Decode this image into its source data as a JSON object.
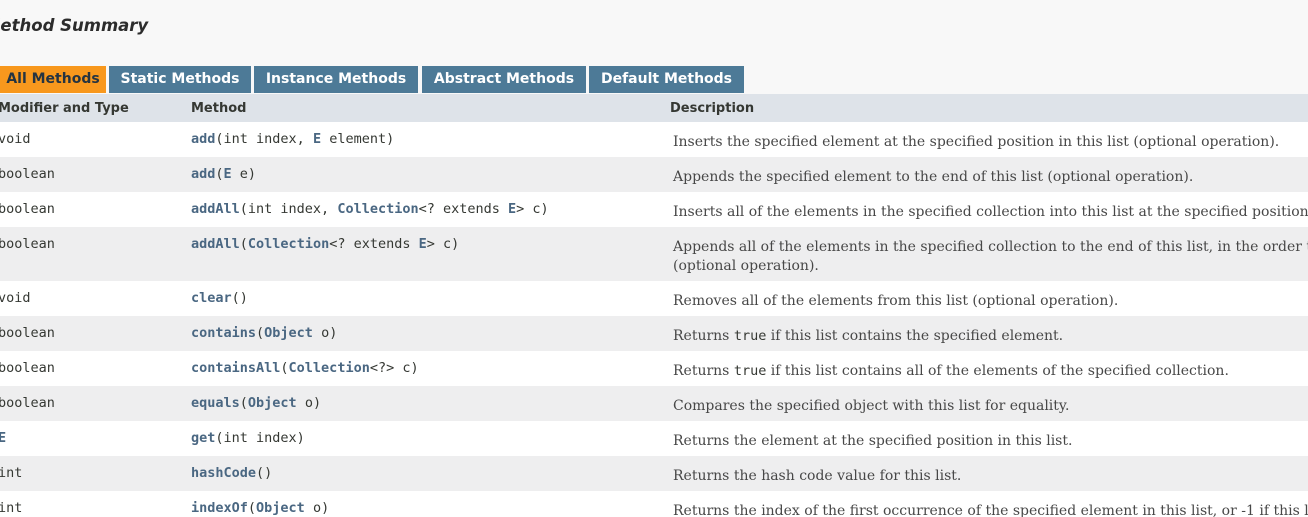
{
  "summary": {
    "title": "Method Summary"
  },
  "tabs": [
    {
      "label": "All Methods",
      "active": true
    },
    {
      "label": "Static Methods",
      "active": false
    },
    {
      "label": "Instance Methods",
      "active": false
    },
    {
      "label": "Abstract Methods",
      "active": false
    },
    {
      "label": "Default Methods",
      "active": false
    }
  ],
  "columns": {
    "type": "Modifier and Type",
    "method": "Method",
    "description": "Description"
  },
  "colors": {
    "active_tab": "#f8981d",
    "inactive_tab": "#4d7a97",
    "header_row": "#dee3e9",
    "alt_row": "#eeeeef",
    "link": "#4a6782"
  },
  "rows": [
    {
      "type": "void",
      "name": "add",
      "sig_parts": [
        "(int index, ",
        "E",
        " element)"
      ],
      "desc": [
        "Inserts the specified element at the specified position in this list (optional operation)."
      ]
    },
    {
      "type": "boolean",
      "name": "add",
      "sig_parts": [
        "(",
        "E",
        " e)"
      ],
      "desc": [
        "Appends the specified element to the end of this list (optional operation)."
      ]
    },
    {
      "type": "boolean",
      "name": "addAll",
      "sig_parts": [
        "(int index, ",
        "Collection",
        "<? extends ",
        "E",
        "> c)"
      ],
      "desc": [
        "Inserts all of the elements in the specified collection into this list at the specified position"
      ]
    },
    {
      "type": "boolean",
      "name": "addAll",
      "sig_parts": [
        "(",
        "Collection",
        "<? extends ",
        "E",
        "> c)"
      ],
      "desc": [
        "Appends all of the elements in the specified collection to the end of this list, in the order t",
        "(optional operation)."
      ]
    },
    {
      "type": "void",
      "name": "clear",
      "sig_parts": [
        "()"
      ],
      "desc": [
        "Removes all of the elements from this list (optional operation)."
      ]
    },
    {
      "type": "boolean",
      "name": "contains",
      "sig_parts": [
        "(",
        "Object",
        " o)"
      ],
      "desc_pre": "Returns ",
      "desc_code": "true",
      "desc_post": " if this list contains the specified element."
    },
    {
      "type": "boolean",
      "name": "containsAll",
      "sig_parts": [
        "(",
        "Collection",
        "<?> c)"
      ],
      "desc_pre": "Returns ",
      "desc_code": "true",
      "desc_post": " if this list contains all of the elements of the specified collection."
    },
    {
      "type": "boolean",
      "name": "equals",
      "sig_parts": [
        "(",
        "Object",
        " o)"
      ],
      "desc": [
        "Compares the specified object with this list for equality."
      ]
    },
    {
      "type": "E",
      "name": "get",
      "sig_parts": [
        "(int index)"
      ],
      "desc": [
        "Returns the element at the specified position in this list."
      ]
    },
    {
      "type": "int",
      "name": "hashCode",
      "sig_parts": [
        "()"
      ],
      "desc": [
        "Returns the hash code value for this list."
      ]
    },
    {
      "type": "int",
      "name": "indexOf",
      "sig_parts": [
        "(",
        "Object",
        " o)"
      ],
      "desc": [
        "Returns the index of the first occurrence of the specified element in this list, or -1 if this l"
      ]
    }
  ]
}
